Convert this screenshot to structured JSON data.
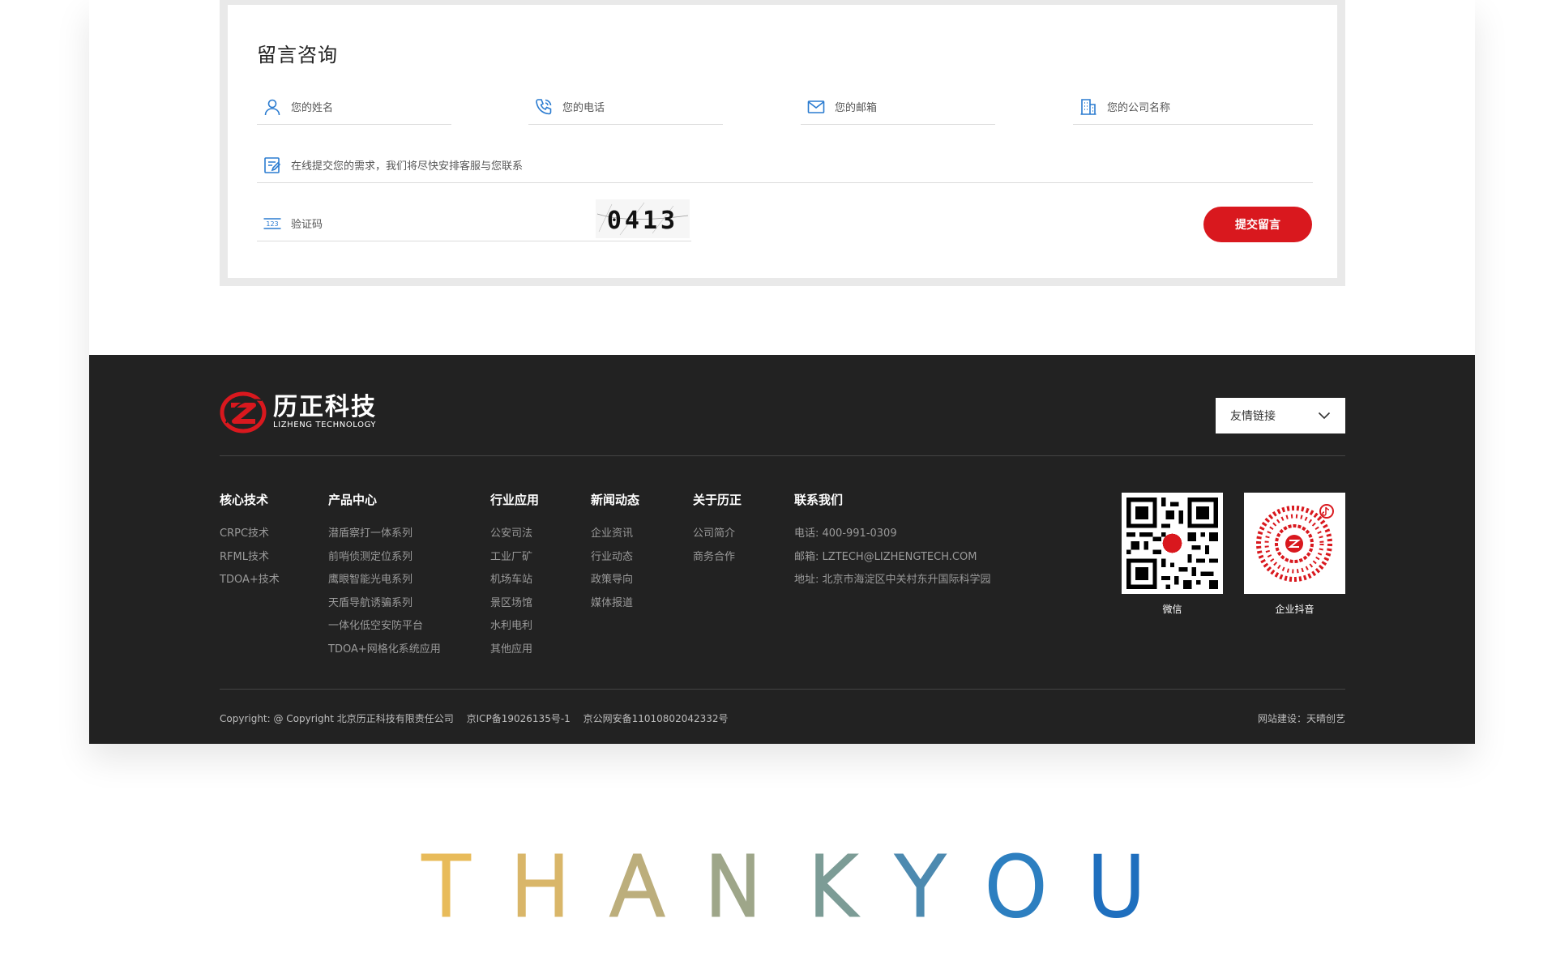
{
  "form": {
    "title": "留言咨询",
    "fields": {
      "name_placeholder": "您的姓名",
      "phone_placeholder": "您的电话",
      "email_placeholder": "您的邮箱",
      "company_placeholder": "您的公司名称",
      "message_placeholder": "在线提交您的需求，我们将尽快安排客服与您联系",
      "captcha_placeholder": "验证码"
    },
    "captcha_code": "0413",
    "submit_label": "提交留言"
  },
  "footer": {
    "brand_cn": "历正科技",
    "brand_en": "LIZHENG TECHNOLOGY",
    "friend_links_label": "友情链接",
    "columns": [
      {
        "title": "核心技术",
        "items": [
          "CRPC技术",
          "RFML技术",
          "TDOA+技术"
        ]
      },
      {
        "title": "产品中心",
        "items": [
          "潜盾察打一体系列",
          "前哨侦测定位系列",
          "鹰眼智能光电系列",
          "天盾导航诱骗系列",
          "一体化低空安防平台",
          "TDOA+网格化系统应用"
        ]
      },
      {
        "title": "行业应用",
        "items": [
          "公安司法",
          "工业厂矿",
          "机场车站",
          "景区场馆",
          "水利电利",
          "其他应用"
        ]
      },
      {
        "title": "新闻动态",
        "items": [
          "企业资讯",
          "行业动态",
          "政策导向",
          "媒体报道"
        ]
      },
      {
        "title": "关于历正",
        "items": [
          "公司简介",
          "商务合作"
        ]
      },
      {
        "title": "联系我们",
        "items": [
          "电话: 400-991-0309",
          "邮箱: LZTECH@LIZHENGTECH.COM",
          "地址: 北京市海淀区中关村东升国际科学园"
        ]
      }
    ],
    "qr": {
      "wechat_label": "微信",
      "douyin_label": "企业抖音"
    },
    "copyright": "Copyright: @ Copyright 北京历正科技有限责任公司",
    "icp": "京ICP备19026135号-1",
    "police": "京公网安备11010802042332号",
    "builder": "网站建设：天晴创艺"
  },
  "thanks": {
    "letters": [
      "T",
      "H",
      "A",
      "N",
      "K",
      "Y",
      "O",
      "U"
    ],
    "colors": [
      "#e8bb5a",
      "#d9b669",
      "#bcae7c",
      "#9ea689",
      "#7c9c96",
      "#4d8ab0",
      "#2d7fc0",
      "#1f6fbe"
    ]
  },
  "colors": {
    "accent": "#d9181e",
    "footer_bg": "#222222",
    "icon_blue": "#2a7bd0"
  },
  "icons": [
    "user-icon",
    "phone-icon",
    "mail-icon",
    "building-icon",
    "edit-icon",
    "number-icon",
    "chevron-down-icon"
  ]
}
